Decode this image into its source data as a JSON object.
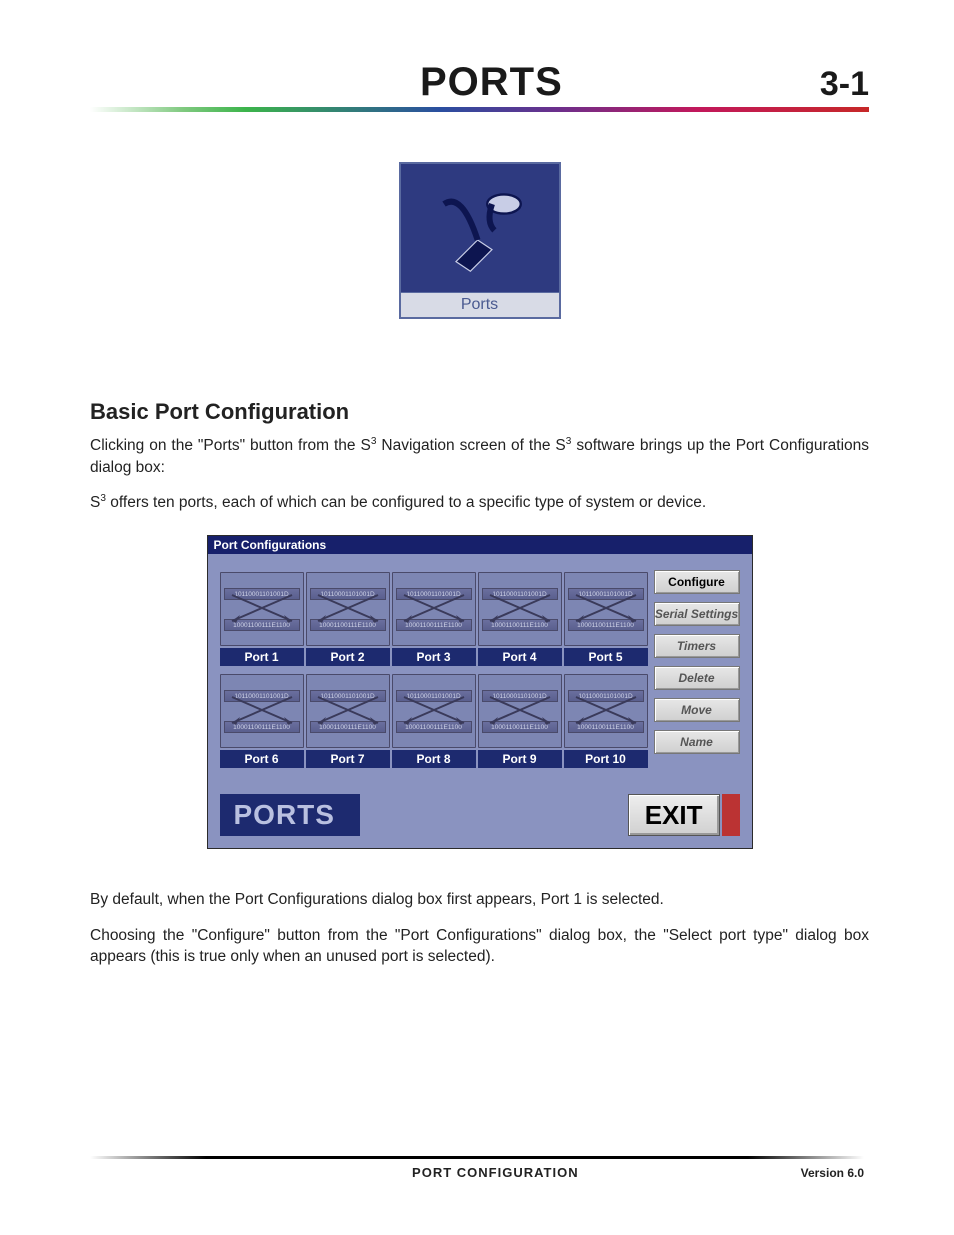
{
  "header": {
    "title": "PORTS",
    "page_number": "3-1"
  },
  "ports_icon": {
    "caption": "Ports"
  },
  "section": {
    "heading": "Basic Port Configuration",
    "para1_a": "Clicking on the \"Ports\" button from the S",
    "para1_b": " Navigation screen of the S",
    "para1_c": " software brings up the Port Configurations dialog box:",
    "para2_a": "S",
    "para2_b": " offers ten ports, each of which can be configured to a specific type of system or device.",
    "para3": "By default, when the Port Configurations dialog box first appears, Port 1 is selected.",
    "para4": "Choosing the \"Configure\" button from the \"Port Configurations\" dialog box, the \"Select port type\" dialog box appears (this is true only when an unused port is selected)."
  },
  "dialog": {
    "title": "Port Configurations",
    "data_top": "10110001101001D",
    "data_bottom": "10001100111E1100",
    "ports": [
      {
        "label": "Port 1"
      },
      {
        "label": "Port 2"
      },
      {
        "label": "Port 3"
      },
      {
        "label": "Port 4"
      },
      {
        "label": "Port 5"
      },
      {
        "label": "Port 6"
      },
      {
        "label": "Port 7"
      },
      {
        "label": "Port 8"
      },
      {
        "label": "Port 9"
      },
      {
        "label": "Port 10"
      }
    ],
    "buttons": {
      "configure": "Configure",
      "serial": "Serial Settings",
      "timers": "Timers",
      "delete": "Delete",
      "move": "Move",
      "name": "Name"
    },
    "banner": "PORTS",
    "exit": "EXIT"
  },
  "footer": {
    "center": "PORT CONFIGURATION",
    "right": "Version 6.0"
  }
}
